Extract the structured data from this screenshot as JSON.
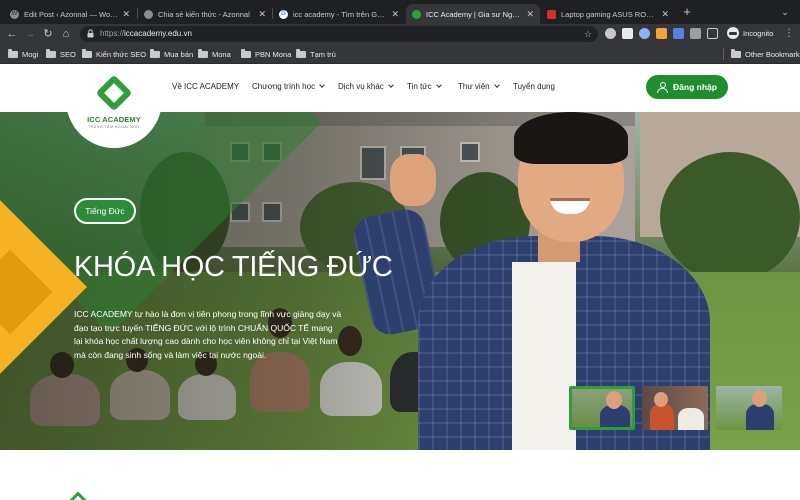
{
  "browser": {
    "tabs": [
      {
        "title": "Edit Post ‹ Azonnal — WordPress",
        "active": false
      },
      {
        "title": "Chia sẻ kiến thức - Azonnal",
        "active": false
      },
      {
        "title": "icc academy - Tìm trên Google",
        "active": false
      },
      {
        "title": "ICC Academy | Gia sư Ngoại ngữ",
        "active": true
      },
      {
        "title": "Laptop gaming ASUS ROG Zephyrus",
        "active": false
      }
    ],
    "new_tab_symbol": "+",
    "url_scheme": "https://",
    "url_host": "iccacademy.edu.vn",
    "incognito_label": "Incognito",
    "bookmarks": [
      "Mogi",
      "SEO",
      "Kiến thức SEO",
      "Mua bán",
      "Mona",
      "PBN Mona",
      "Tạm trú"
    ],
    "other_bookmarks": "Other Bookmarks"
  },
  "site": {
    "logo_text": "ICC ACADEMY",
    "logo_tagline": "TRUNG TÂM NGOẠI NGỮ",
    "nav": [
      {
        "label": "Về ICC ACADEMY",
        "dropdown": false
      },
      {
        "label": "Chương trình học",
        "dropdown": true
      },
      {
        "label": "Dịch vụ khác",
        "dropdown": true
      },
      {
        "label": "Tin tức",
        "dropdown": true
      },
      {
        "label": "Thư viện",
        "dropdown": true
      },
      {
        "label": "Tuyển dụng",
        "dropdown": false
      }
    ],
    "login_label": "Đăng nhập"
  },
  "hero": {
    "badge": "Tiếng Đức",
    "title": "KHÓA HỌC TIẾNG ĐỨC",
    "description": "ICC ACADEMY tự hào là đơn vị tiên phong trong lĩnh vực giảng dạy và đạo tạo trực tuyến TIẾNG ĐỨC với lộ trình CHUẨN QUỐC TẾ mang lại khóa học chất lượng cao dành cho học viên không chỉ tại Việt Nam mà còn đang sinh sống và làm việc tại nước ngoài.",
    "thumbnails_active_index": 0
  },
  "colors": {
    "brand_green": "#2e9e3a",
    "accent_yellow": "#f5b324",
    "browser_dark": "#35363a"
  }
}
